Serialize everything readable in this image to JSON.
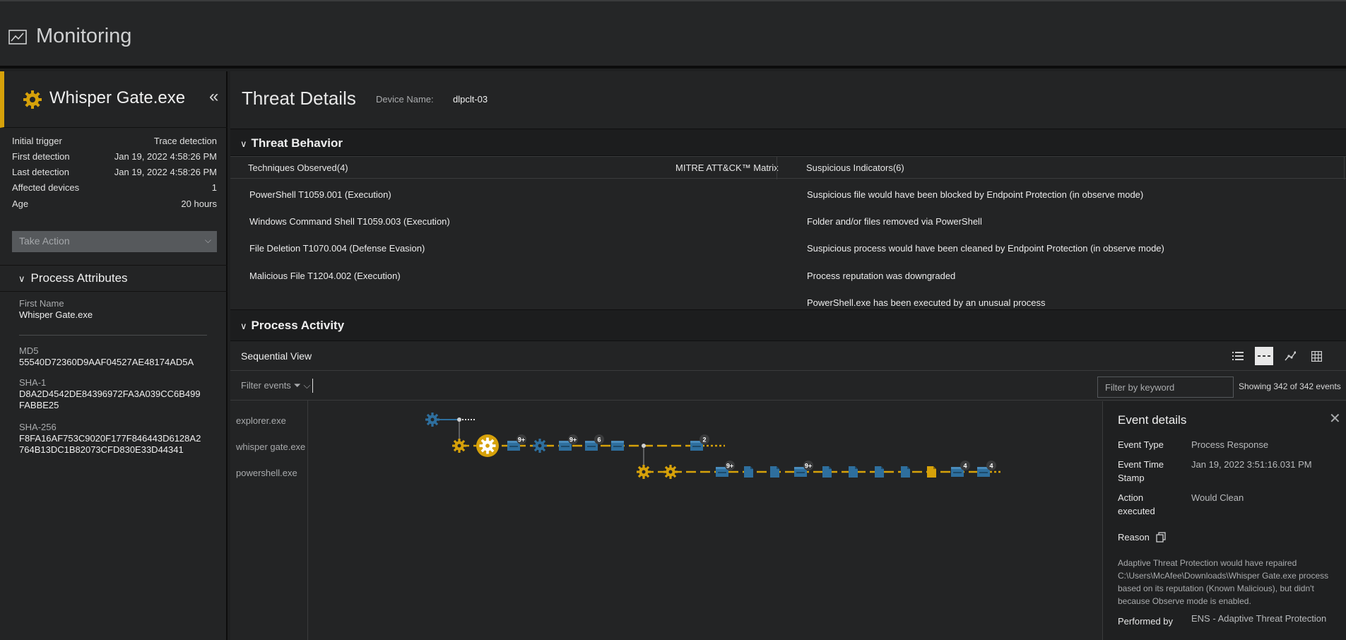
{
  "app": {
    "title": "Monitoring",
    "icon": "line-chart-icon"
  },
  "threat": {
    "name": "Whisper Gate.exe",
    "icon": "gear-icon",
    "summary": [
      {
        "label": "Initial trigger",
        "value": "Trace detection"
      },
      {
        "label": "First detection",
        "value": "Jan 19, 2022 4:58:26 PM"
      },
      {
        "label": "Last detection",
        "value": "Jan 19, 2022 4:58:26 PM"
      },
      {
        "label": "Affected devices",
        "value": "1"
      },
      {
        "label": "Age",
        "value": "20 hours"
      }
    ],
    "take_action": "Take Action"
  },
  "process_attributes": {
    "title": "Process Attributes",
    "first_name_label": "First Name",
    "first_name": "Whisper Gate.exe",
    "md5_label": "MD5",
    "md5": "55540D72360D9AAF04527AE48174AD5A",
    "sha1_label": "SHA-1",
    "sha1": "D8A2D4542DE84396972FA3A039CC6B499FABBE25",
    "sha256_label": "SHA-256",
    "sha256": "F8FA16AF753C9020F177F846443D6128A2764B13DC1B82073CFD830E33D44341"
  },
  "details": {
    "title": "Threat Details",
    "device_label": "Device Name:",
    "device_name": "dlpclt-03"
  },
  "behavior": {
    "title": "Threat Behavior",
    "techniques_header": "Techniques Observed(4)",
    "mitre_header": "MITRE ATT&CK™ Matrix",
    "indicators_header": "Suspicious Indicators(6)",
    "techniques": [
      "PowerShell T1059.001 (Execution)",
      "Windows Command Shell T1059.003 (Execution)",
      "File Deletion T1070.004 (Defense Evasion)",
      "Malicious File T1204.002 (Execution)"
    ],
    "indicators": [
      "Suspicious file would have been blocked by Endpoint Protection (in observe mode)",
      "Folder and/or files removed via PowerShell",
      "Suspicious process would have been cleaned by Endpoint Protection (in observe mode)",
      "Process reputation was downgraded",
      "PowerShell.exe has been executed by an unusual process"
    ]
  },
  "activity": {
    "title": "Process Activity",
    "view_title": "Sequential View",
    "view_buttons": [
      "list-view-icon",
      "sequential-view-icon",
      "graph-view-icon",
      "grid-view-icon"
    ],
    "filter_events": "Filter events",
    "keyword_placeholder": "Filter by keyword",
    "showing": "Showing 342 of 342 events",
    "lanes": [
      "explorer.exe",
      "whisper gate.exe",
      "powershell.exe"
    ],
    "badges": [
      "9+",
      "9+",
      "6",
      "2",
      "9+",
      "9+",
      "4",
      "4"
    ]
  },
  "event_details": {
    "title": "Event details",
    "event_type_label": "Event Type",
    "event_type": "Process Response",
    "event_time_label": "Event Time Stamp",
    "event_time": "Jan 19, 2022 3:51:16.031 PM",
    "action_label": "Action executed",
    "action": "Would Clean",
    "reason_label": "Reason",
    "reason": "Adaptive Threat Protection would have repaired C:\\Users\\McAfee\\Downloads\\Whisper Gate.exe process based on its reputation (Known Malicious), but didn't because Observe mode is enabled.",
    "performed_label": "Performed by",
    "performed": "ENS - Adaptive Threat Protection"
  },
  "colors": {
    "accent": "#d6a10a",
    "node_blue": "#2e6f9e",
    "background": "#232425"
  }
}
